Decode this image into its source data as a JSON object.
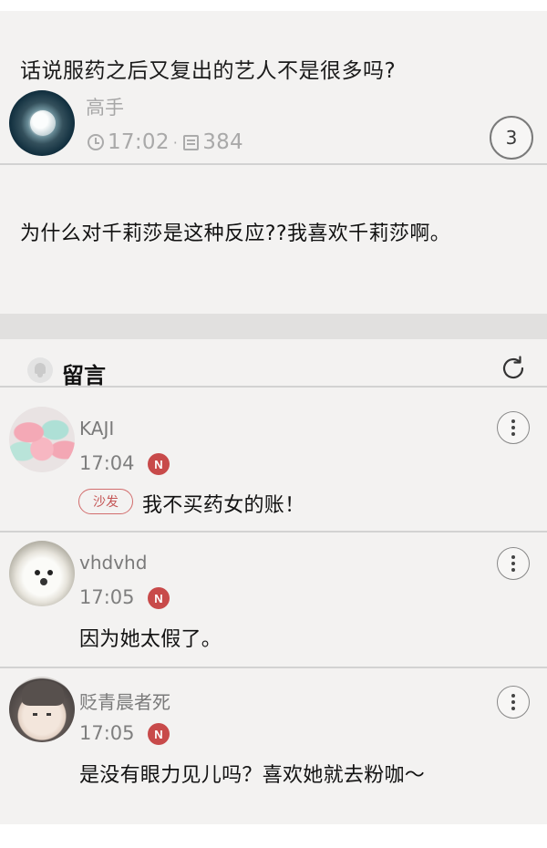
{
  "post": {
    "title": "话说服药之后又复出的艺人不是很多吗?",
    "author": "高手",
    "time": "17:02",
    "meta_separator": "·",
    "views": "384",
    "reply_count": "3",
    "body": "为什么对千莉莎是这种反应??我喜欢千莉莎啊。",
    "icons": {
      "time": "clock-icon",
      "views": "list-icon",
      "avatar": "moon-avatar"
    }
  },
  "comments_section": {
    "title": "留言",
    "icons": {
      "header": "bell-icon",
      "refresh": "refresh-icon",
      "more": "more-vertical-icon"
    }
  },
  "comments": [
    {
      "user": "KAJI",
      "time": "17:04",
      "badge": "N",
      "tag": "沙发",
      "text": "我不买药女的账！"
    },
    {
      "user": "vhdvhd",
      "time": "17:05",
      "badge": "N",
      "text": "因为她太假了。"
    },
    {
      "user": "贬青晨者死",
      "time": "17:05",
      "badge": "N",
      "text": "是没有眼力见儿吗？喜欢她就去粉咖～"
    }
  ],
  "colors": {
    "new_badge": "#c84a4a",
    "sofa_tag": "#c45555",
    "background": "#f3f2f1"
  }
}
